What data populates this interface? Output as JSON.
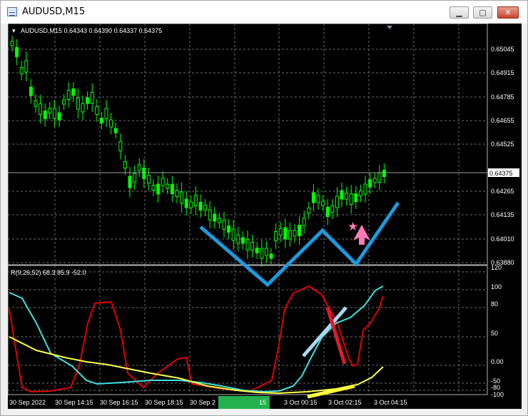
{
  "window": {
    "title": "AUDUSD,M15",
    "minimize_glyph": "▁",
    "maximize_glyph": "▢",
    "close_glyph": "✕"
  },
  "chart": {
    "header": "AUDUSD,M15  0.64343 0.64390 0.64337 0.64375",
    "current_price": "0.64375",
    "price_ticks": [
      "0.65045",
      "0.64915",
      "0.64785",
      "0.64655",
      "0.64525",
      "0.64265",
      "0.64135",
      "0.64010",
      "0.63880"
    ],
    "indicator_label": "R(9,26,52) 68.3 85.9 -52.0",
    "indicator_ticks": [
      "120",
      "100",
      "80",
      "50",
      "0.00",
      "-50",
      "-80",
      "-100"
    ],
    "time_labels": [
      "30 Sep 2022",
      "30 Sep 14:15",
      "30 Sep 16:15",
      "30 Sep 18:15",
      "30 Sep 2",
      "15",
      "3 Oct 00:15",
      "3 Oct 02:15",
      "3 Oct 04:15"
    ],
    "colors": {
      "background": "#000000",
      "bull_candle": "#00ff00",
      "grid": "#6e6e6e",
      "zigzag": "#1a9be0",
      "red_line": "#e00000",
      "cyan_line": "#40e0e0",
      "yellow_line": "#ffff40",
      "star": "#ff7ab6",
      "green_bar": "#22b14c"
    }
  }
}
